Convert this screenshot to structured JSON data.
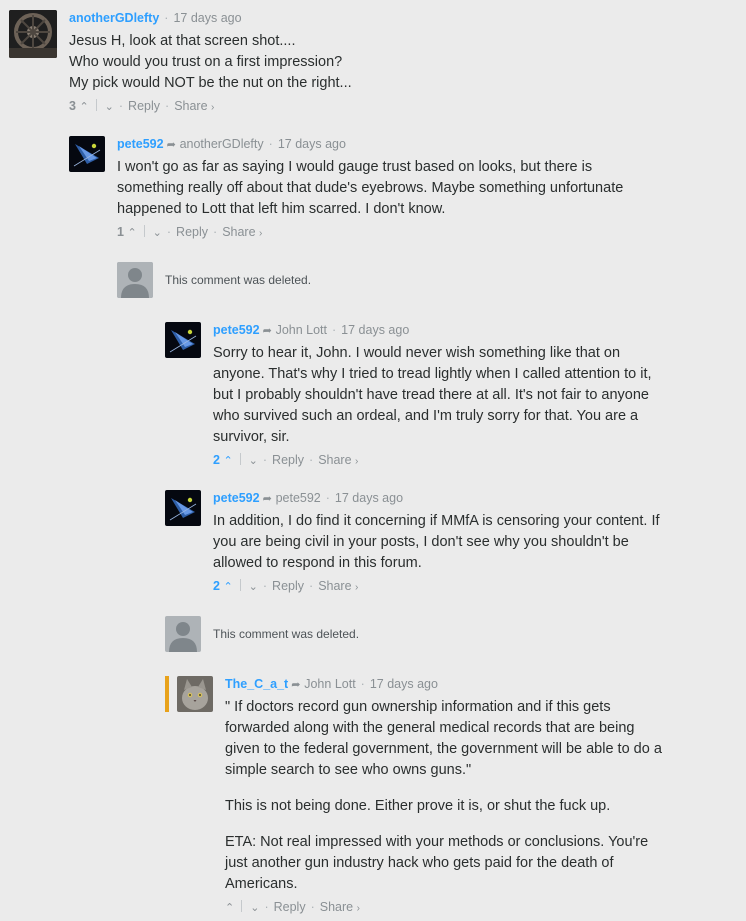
{
  "ui": {
    "arrow_glyph": "➦",
    "bullet": "·",
    "up_glyph": "⌃",
    "down_glyph": "⌄",
    "share_chevron": "›"
  },
  "comments": [
    {
      "author": "anotherGDlefty",
      "time": "17 days ago",
      "lines": [
        "Jesus H, look at that screen shot....",
        "Who would you trust on a first impression?",
        "My pick would NOT be the nut on the right..."
      ],
      "votes": "3",
      "reply": "Reply",
      "share": "Share"
    },
    {
      "author": "pete592",
      "reply_to": "anotherGDlefty",
      "time": "17 days ago",
      "lines": [
        "I won't go as far as saying I would gauge trust based on looks, but there is something really off about that dude's eyebrows. Maybe something unfortunate happened to Lott that left him scarred. I don't know."
      ],
      "votes": "1",
      "reply": "Reply",
      "share": "Share"
    },
    {
      "deleted": "This comment was deleted."
    },
    {
      "author": "pete592",
      "reply_to": "John Lott",
      "time": "17 days ago",
      "lines": [
        "Sorry to hear it, John. I would never wish something like that on anyone. That's why I tried to tread lightly when I called attention to it, but I probably shouldn't have tread there at all. It's not fair to anyone who survived such an ordeal, and I'm truly sorry for that. You are a survivor, sir."
      ],
      "votes": "2",
      "reply": "Reply",
      "share": "Share"
    },
    {
      "author": "pete592",
      "reply_to": "pete592",
      "time": "17 days ago",
      "lines": [
        "In addition, I do find it concerning if MMfA is censoring your content. If you are being civil in your posts, I don't see why you shouldn't be allowed to respond in this forum."
      ],
      "votes": "2",
      "reply": "Reply",
      "share": "Share"
    },
    {
      "deleted": "This comment was deleted."
    },
    {
      "author": "The_C_a_t",
      "reply_to": "John Lott",
      "time": "17 days ago",
      "paragraphs": [
        "\" If doctors record gun ownership information and if this gets forwarded along with the general medical records that are being given to the federal government, the government will be able to do a simple search to see who owns guns.\"",
        "This is not being done. Either prove it is, or shut the fuck up.",
        "ETA: Not real impressed with your methods or conclusions. You're just another gun industry hack who gets paid for the death of Americans."
      ],
      "votes": "",
      "reply": "Reply",
      "share": "Share"
    }
  ]
}
